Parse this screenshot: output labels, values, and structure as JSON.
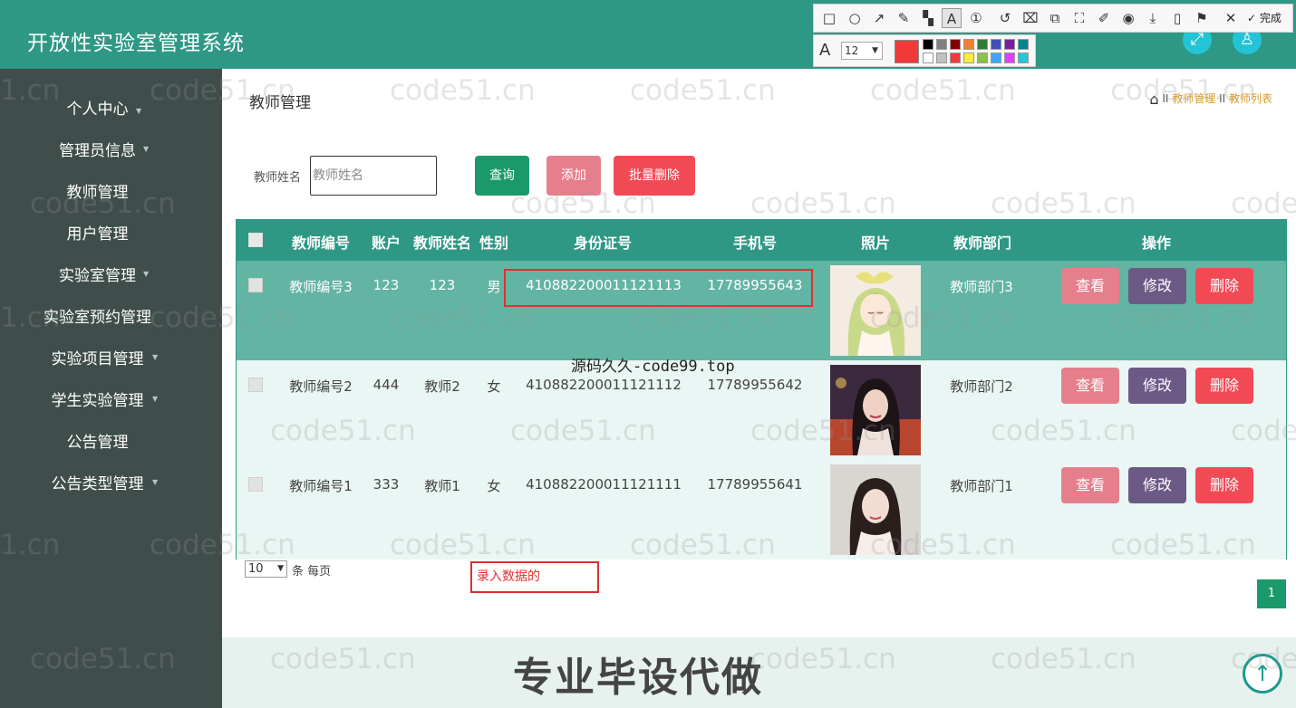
{
  "header": {
    "title": "开放性实验室管理系统",
    "fullscreen_icon": "expand-icon",
    "user_icon": "user-icon"
  },
  "annotation_toolbar": {
    "tools": [
      "rectangle-icon",
      "ellipse-icon",
      "arrow-icon",
      "pencil-icon",
      "mosaic-icon",
      "text-icon",
      "number-icon",
      "undo-icon",
      "delete-icon",
      "copy-icon",
      "fullscreen-icon",
      "pin-icon",
      "record-icon",
      "download-icon",
      "phone-icon",
      "bookmark-icon",
      "close-icon",
      "check-icon"
    ],
    "done_label": "完成",
    "font_size": "12",
    "current_color": "#f03a3a",
    "palette": [
      "#000000",
      "#808080",
      "#800000",
      "#ef8033",
      "#2e7d32",
      "#3f51b5",
      "#7b1fa2",
      "#00838f",
      "#ffffff",
      "#c0c0c0",
      "#f03a3a",
      "#ffeb3b",
      "#8bc34a",
      "#42a5f5",
      "#e040fb",
      "#26c6da"
    ]
  },
  "sidebar": {
    "items": [
      {
        "label": "个人中心"
      },
      {
        "label": "管理员信息"
      },
      {
        "label": "教师管理"
      },
      {
        "label": "用户管理"
      },
      {
        "label": "实验室管理"
      },
      {
        "label": "实验室预约管理"
      },
      {
        "label": "实验项目管理"
      },
      {
        "label": "学生实验管理"
      },
      {
        "label": "公告管理"
      },
      {
        "label": "公告类型管理"
      }
    ]
  },
  "page": {
    "title": "教师管理",
    "breadcrumb": {
      "home_icon": "home-icon",
      "sep": "II",
      "level1": "教师管理",
      "level2": "教师列表"
    }
  },
  "search": {
    "label": "教师姓名",
    "placeholder": "教师姓名",
    "value": ""
  },
  "buttons": {
    "query": "查询",
    "add": "添加",
    "batch_delete": "批量删除"
  },
  "table": {
    "columns": [
      "教师编号",
      "账户",
      "教师姓名",
      "性别",
      "身份证号",
      "手机号",
      "照片",
      "教师部门",
      "操作"
    ],
    "rows": [
      {
        "id": "教师编号3",
        "account": "123",
        "name": "123",
        "gender": "男",
        "id_card": "410882200011121113",
        "phone": "17789955643",
        "dept": "教师部门3",
        "photo": "anime-girl-photo"
      },
      {
        "id": "教师编号2",
        "account": "444",
        "name": "教师2",
        "gender": "女",
        "id_card": "410882200011121112",
        "phone": "17789955642",
        "dept": "教师部门2",
        "photo": "woman-photo"
      },
      {
        "id": "教师编号1",
        "account": "333",
        "name": "教师1",
        "gender": "女",
        "id_card": "410882200011121111",
        "phone": "17789955641",
        "dept": "教师部门1",
        "photo": "woman-photo"
      }
    ],
    "actions": {
      "view": "查看",
      "edit": "修改",
      "delete": "删除"
    }
  },
  "pagination": {
    "page_size": "10",
    "per_page_text": "条 每页",
    "current_page": "1"
  },
  "overlays": {
    "annotation_text": "录入数据的",
    "source_tag": "源码久久-code99.top",
    "promo": "专业毕设代做",
    "watermark": "code51.cn",
    "watermark_fragment": "1.cn",
    "back_to_top_icon": "arrow-up-icon"
  }
}
